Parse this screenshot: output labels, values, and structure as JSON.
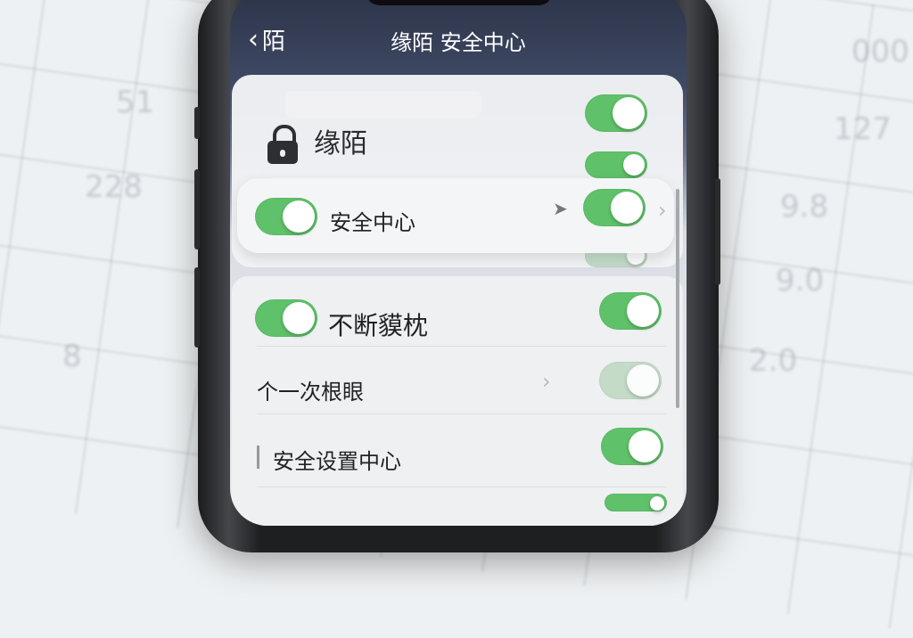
{
  "background": {
    "numbers": [
      "51",
      "228",
      "9.8",
      "127",
      "9.0",
      "2.0",
      "000",
      "8"
    ]
  },
  "nav": {
    "back_label": "陌",
    "back_icon": "chevron-left-icon",
    "title": "缘陌 安全中心"
  },
  "app": {
    "name": "缘陌",
    "icon": "lock-icon"
  },
  "featured": {
    "label": "安全中心",
    "toggle_on": true
  },
  "settings": [
    {
      "label": "不断貘枕",
      "toggle_on": true
    },
    {
      "label": "个一次根眼",
      "toggle_on": true,
      "faded": true
    },
    {
      "label": "安全设置中心",
      "toggle_on": true
    }
  ],
  "colors": {
    "toggle_on": "#5fc26a",
    "header_bg": "#2c3448"
  }
}
